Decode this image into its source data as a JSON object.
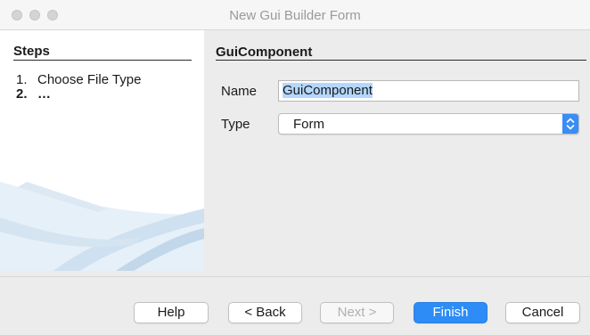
{
  "window": {
    "title": "New Gui Builder Form"
  },
  "steps": {
    "heading": "Steps",
    "items": [
      {
        "num": "1.",
        "label": "Choose File Type"
      },
      {
        "num": "2.",
        "label": "…"
      }
    ]
  },
  "panel": {
    "heading": "GuiComponent"
  },
  "form": {
    "name_label": "Name",
    "name_value": "GuiComponent",
    "type_label": "Type",
    "type_value": "Form"
  },
  "buttons": {
    "help": "Help",
    "back": "< Back",
    "next": "Next >",
    "finish": "Finish",
    "cancel": "Cancel"
  },
  "colors": {
    "accent": "#2d8cf5",
    "selection": "#b3d7ff"
  },
  "icons": {
    "select_arrow": "chevron-updown-icon",
    "wizard_art": "swoosh-graphic"
  }
}
